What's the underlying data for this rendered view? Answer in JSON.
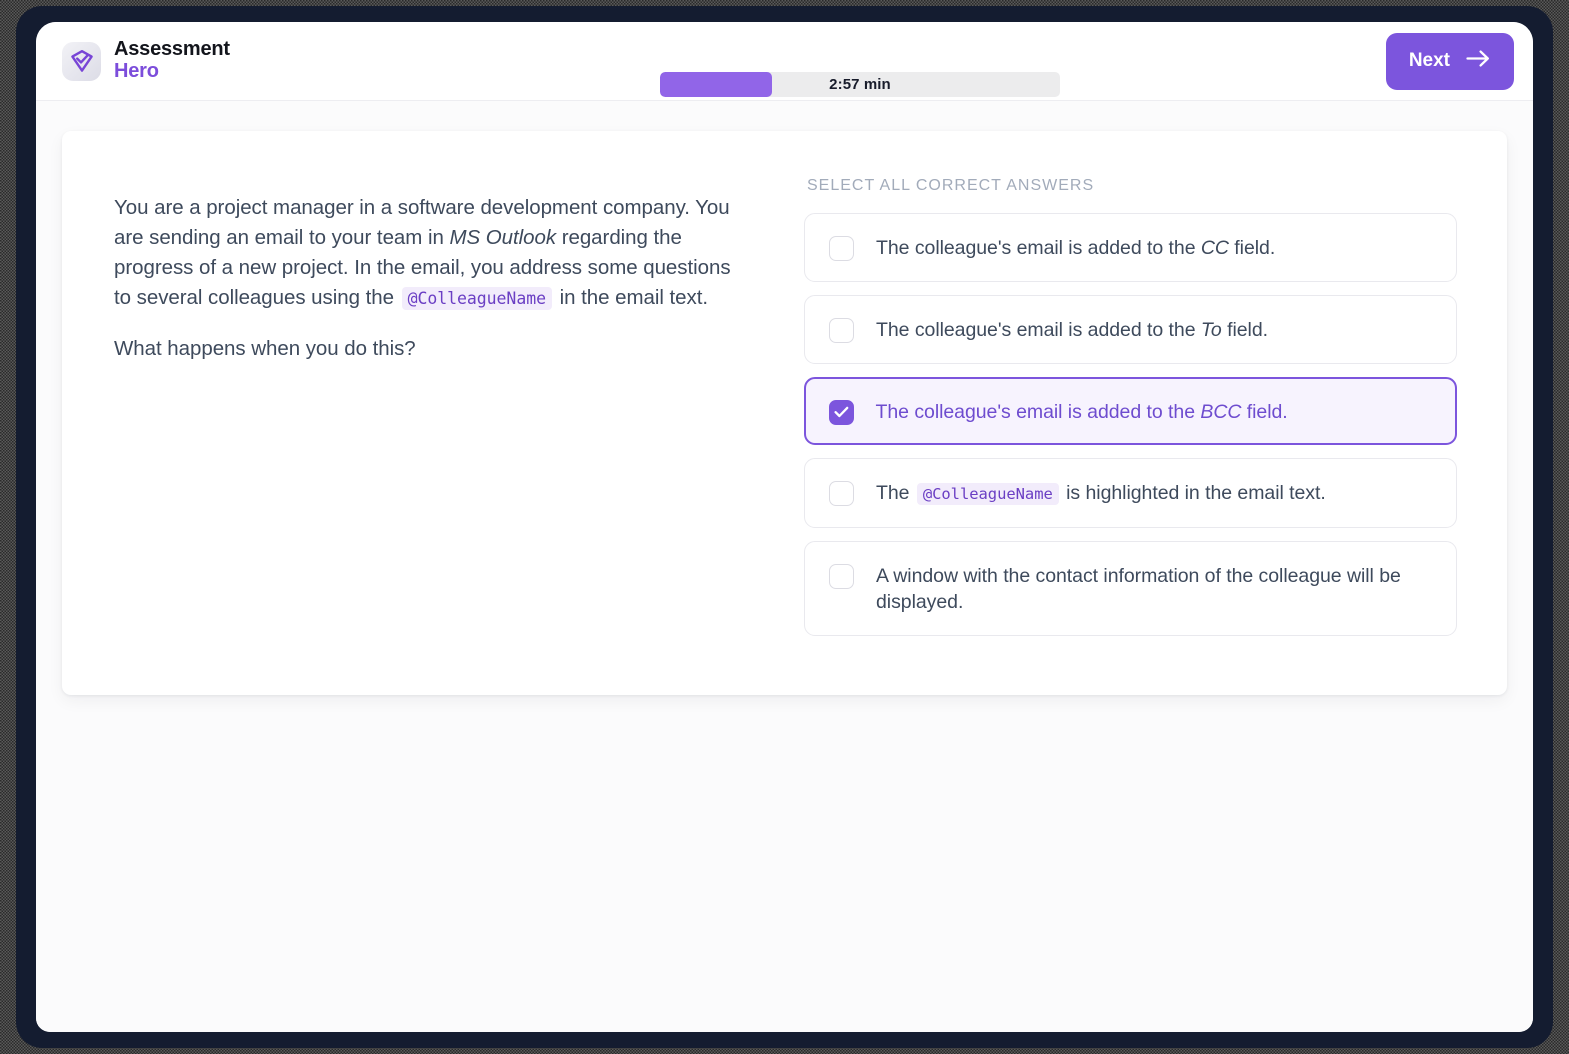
{
  "brand": {
    "line1": "Assessment",
    "line2": "Hero",
    "logo_icon": "shield-check-icon",
    "accent_color": "#7c4ddb"
  },
  "header": {
    "timer": {
      "label": "2:57 min",
      "percent": 28,
      "fill_color": "#9165e8",
      "track_color": "#ececed"
    },
    "next_button": {
      "label": "Next",
      "icon": "arrow-right-icon",
      "background_color": "#7c55dd"
    }
  },
  "question": {
    "stem": {
      "p1_a": "You are a project manager in a software development company. You are sending an email to your team in ",
      "p1_em": "MS Outlook",
      "p1_b": " regarding the progress of a new project. In the email, you address some questions to several colleagues using the ",
      "p1_code": "@ColleagueName",
      "p1_c": " in the email text.",
      "p2": "What happens when you do this?"
    }
  },
  "answers": {
    "heading": "SELECT ALL CORRECT ANSWERS",
    "options": [
      {
        "a": "The colleague's email is added to the ",
        "em": "CC",
        "b": " field.",
        "code": "",
        "c": "",
        "checked": false
      },
      {
        "a": "The colleague's email is added to the ",
        "em": "To",
        "b": " field.",
        "code": "",
        "c": "",
        "checked": false
      },
      {
        "a": "The colleague's email is added to the ",
        "em": "BCC",
        "b": " field.",
        "code": "",
        "c": "",
        "checked": true
      },
      {
        "a": "The ",
        "em": "",
        "b": "",
        "code": "@ColleagueName",
        "c": " is highlighted in the email text.",
        "checked": false
      },
      {
        "a": "A window with the contact information of the colleague will be displayed.",
        "em": "",
        "b": "",
        "code": "",
        "c": "",
        "checked": false
      }
    ],
    "selected_color": "#7c55dd"
  }
}
